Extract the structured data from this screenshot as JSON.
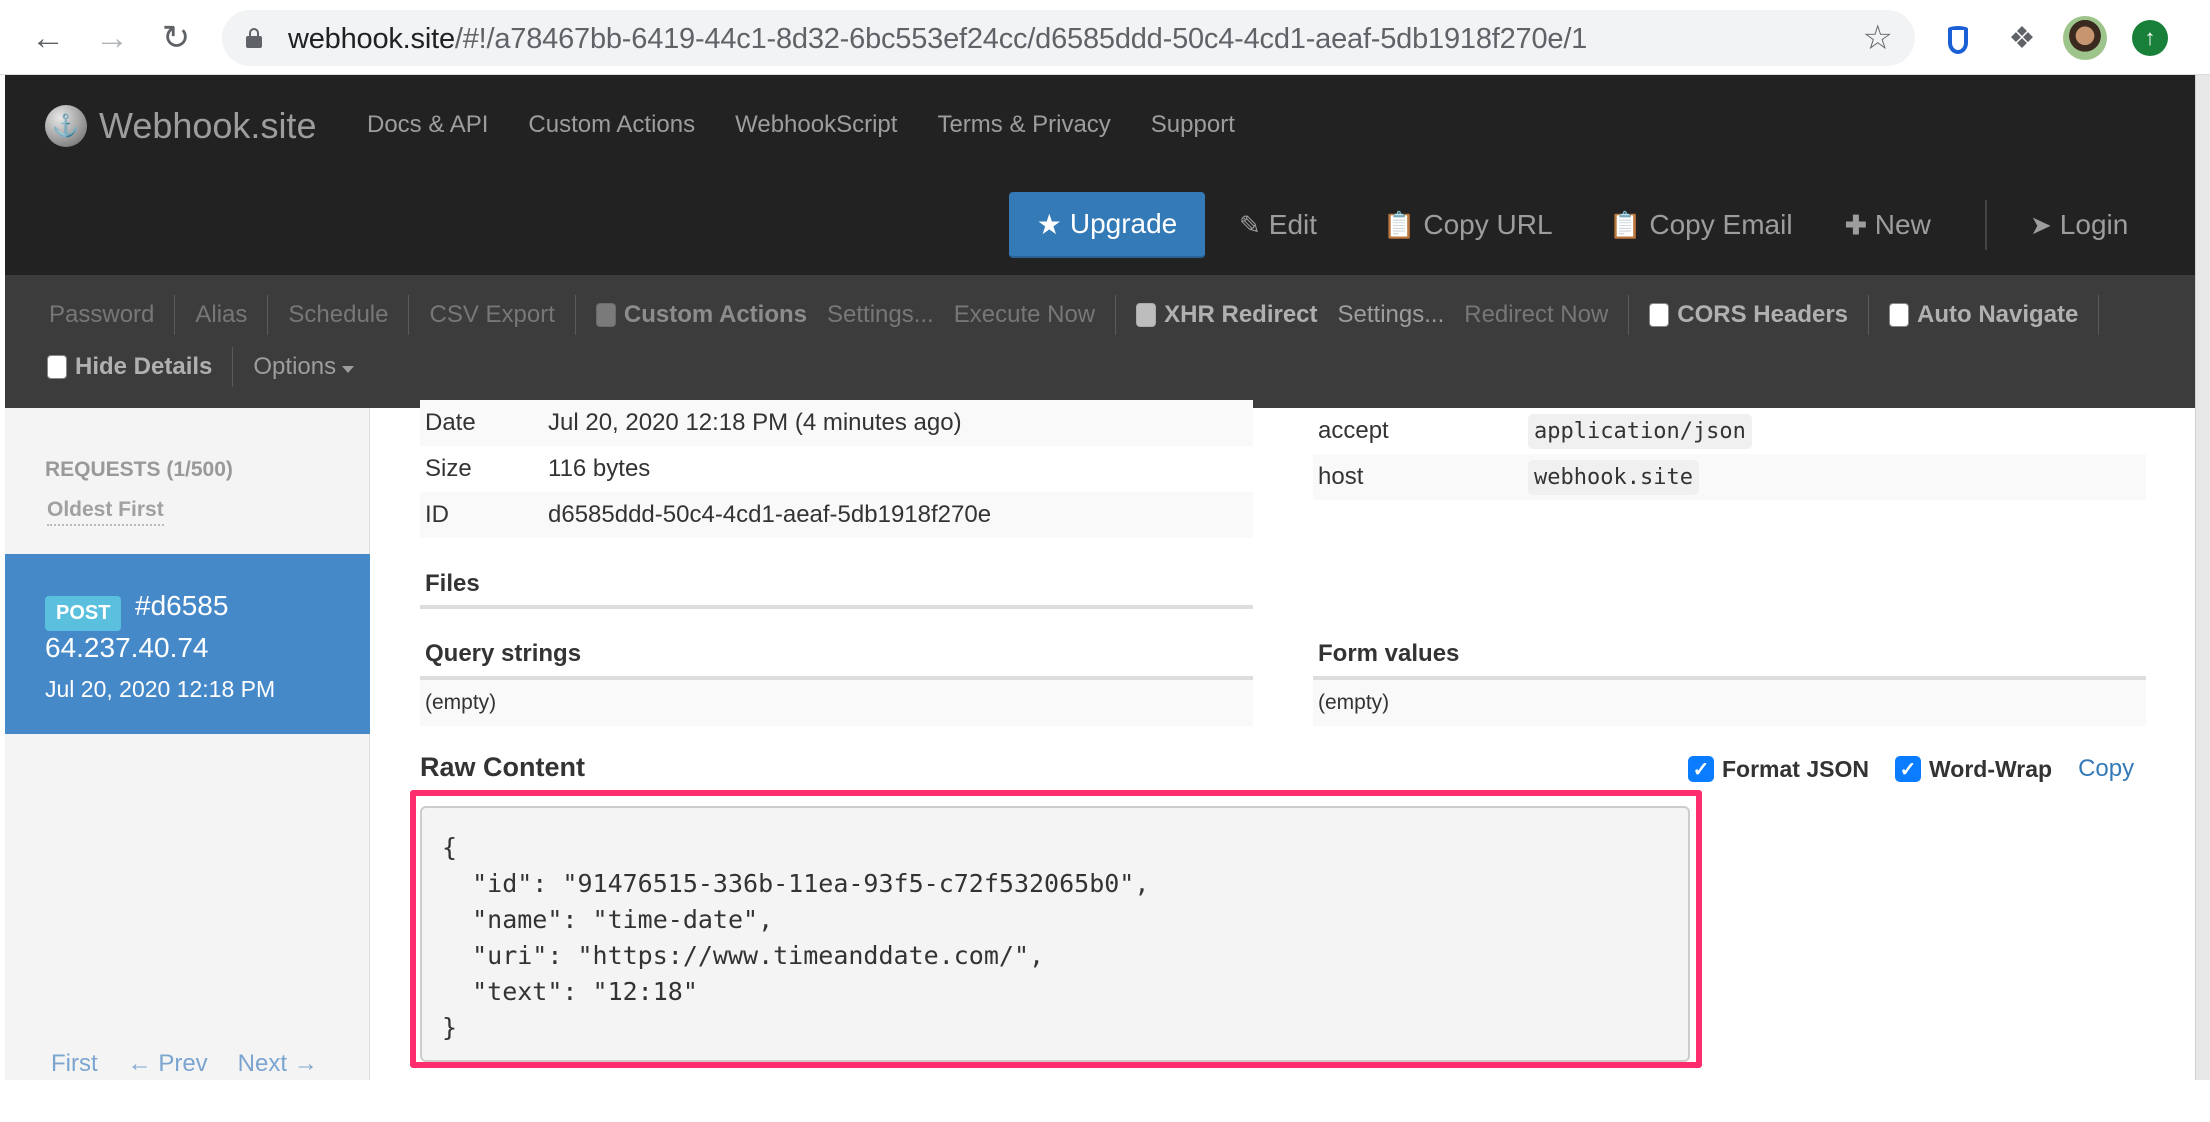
{
  "browser": {
    "url_host": "webhook.site",
    "url_path": "/#!/a78467bb-6419-44c1-8d32-6bc553ef24cc/d6585ddd-50c4-4cd1-aeaf-5db1918f270e/1",
    "icons": [
      "back-arrow-icon",
      "forward-arrow-icon",
      "reload-icon",
      "lock-icon",
      "bookmark-star-icon",
      "extension-drop-icon",
      "extensions-puzzle-icon",
      "profile-avatar",
      "update-icon"
    ]
  },
  "navbar": {
    "brand": "Webhook.site",
    "links": [
      "Docs & API",
      "Custom Actions",
      "WebhookScript",
      "Terms & Privacy",
      "Support"
    ],
    "actions": {
      "upgrade": "Upgrade",
      "edit": "Edit",
      "copy_url": "Copy URL",
      "copy_email": "Copy Email",
      "new": "New",
      "login": "Login"
    },
    "accent_color": "#337ab7"
  },
  "toolbar": {
    "password": "Password",
    "alias": "Alias",
    "schedule": "Schedule",
    "csv_export": "CSV Export",
    "custom_actions": "Custom Actions",
    "custom_actions_settings": "Settings...",
    "execute_now": "Execute Now",
    "xhr_redirect": "XHR Redirect",
    "xhr_settings": "Settings...",
    "redirect_now": "Redirect Now",
    "cors_headers": "CORS Headers",
    "auto_navigate": "Auto Navigate",
    "hide_details": "Hide Details",
    "options": "Options",
    "checkboxes": {
      "custom_actions": false,
      "xhr_redirect": false,
      "cors_headers": false,
      "auto_navigate": false,
      "hide_details": false
    }
  },
  "sidebar": {
    "requests_label": "REQUESTS (1/500)",
    "sort_label": "Oldest First",
    "selected_request": {
      "method": "POST",
      "hash": "#d6585",
      "ip": "64.237.40.74",
      "date": "Jul 20, 2020 12:18 PM"
    },
    "pager": {
      "first": "First",
      "prev": "← Prev",
      "next": "Next →"
    },
    "selected_color": "#4589c9"
  },
  "details": {
    "rows": [
      {
        "key": "Date",
        "value": "Jul 20, 2020 12:18 PM (4 minutes ago)"
      },
      {
        "key": "Size",
        "value": "116 bytes"
      },
      {
        "key": "ID",
        "value": "d6585ddd-50c4-4cd1-aeaf-5db1918f270e"
      }
    ],
    "files_title": "Files",
    "query_strings_title": "Query strings",
    "query_strings_value": "(empty)"
  },
  "headers": {
    "rows": [
      {
        "key": "accept",
        "value": "application/json"
      },
      {
        "key": "host",
        "value": "webhook.site"
      }
    ],
    "form_values_title": "Form values",
    "form_values_value": "(empty)"
  },
  "raw_content": {
    "title": "Raw Content",
    "format_json_label": "Format JSON",
    "format_json_checked": true,
    "word_wrap_label": "Word-Wrap",
    "word_wrap_checked": true,
    "copy_label": "Copy",
    "body": "{\n  \"id\": \"91476515-336b-11ea-93f5-c72f532065b0\",\n  \"name\": \"time-date\",\n  \"uri\": \"https://www.timeanddate.com/\",\n  \"text\": \"12:18\"\n}",
    "highlight_color": "#ff2d6e"
  }
}
